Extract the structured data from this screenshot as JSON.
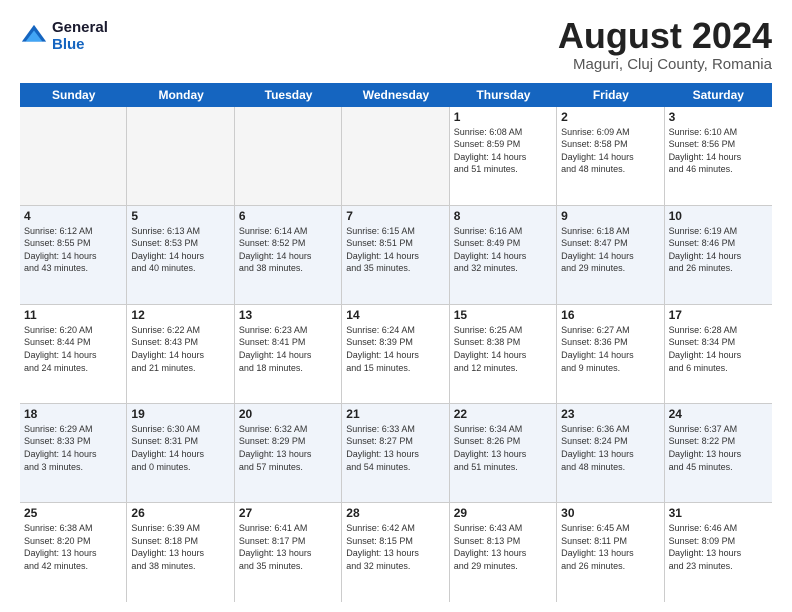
{
  "logo": {
    "general": "General",
    "blue": "Blue"
  },
  "title": "August 2024",
  "location": "Maguri, Cluj County, Romania",
  "days_of_week": [
    "Sunday",
    "Monday",
    "Tuesday",
    "Wednesday",
    "Thursday",
    "Friday",
    "Saturday"
  ],
  "weeks": [
    [
      {
        "day": "",
        "info": ""
      },
      {
        "day": "",
        "info": ""
      },
      {
        "day": "",
        "info": ""
      },
      {
        "day": "",
        "info": ""
      },
      {
        "day": "1",
        "info": "Sunrise: 6:08 AM\nSunset: 8:59 PM\nDaylight: 14 hours\nand 51 minutes."
      },
      {
        "day": "2",
        "info": "Sunrise: 6:09 AM\nSunset: 8:58 PM\nDaylight: 14 hours\nand 48 minutes."
      },
      {
        "day": "3",
        "info": "Sunrise: 6:10 AM\nSunset: 8:56 PM\nDaylight: 14 hours\nand 46 minutes."
      }
    ],
    [
      {
        "day": "4",
        "info": "Sunrise: 6:12 AM\nSunset: 8:55 PM\nDaylight: 14 hours\nand 43 minutes."
      },
      {
        "day": "5",
        "info": "Sunrise: 6:13 AM\nSunset: 8:53 PM\nDaylight: 14 hours\nand 40 minutes."
      },
      {
        "day": "6",
        "info": "Sunrise: 6:14 AM\nSunset: 8:52 PM\nDaylight: 14 hours\nand 38 minutes."
      },
      {
        "day": "7",
        "info": "Sunrise: 6:15 AM\nSunset: 8:51 PM\nDaylight: 14 hours\nand 35 minutes."
      },
      {
        "day": "8",
        "info": "Sunrise: 6:16 AM\nSunset: 8:49 PM\nDaylight: 14 hours\nand 32 minutes."
      },
      {
        "day": "9",
        "info": "Sunrise: 6:18 AM\nSunset: 8:47 PM\nDaylight: 14 hours\nand 29 minutes."
      },
      {
        "day": "10",
        "info": "Sunrise: 6:19 AM\nSunset: 8:46 PM\nDaylight: 14 hours\nand 26 minutes."
      }
    ],
    [
      {
        "day": "11",
        "info": "Sunrise: 6:20 AM\nSunset: 8:44 PM\nDaylight: 14 hours\nand 24 minutes."
      },
      {
        "day": "12",
        "info": "Sunrise: 6:22 AM\nSunset: 8:43 PM\nDaylight: 14 hours\nand 21 minutes."
      },
      {
        "day": "13",
        "info": "Sunrise: 6:23 AM\nSunset: 8:41 PM\nDaylight: 14 hours\nand 18 minutes."
      },
      {
        "day": "14",
        "info": "Sunrise: 6:24 AM\nSunset: 8:39 PM\nDaylight: 14 hours\nand 15 minutes."
      },
      {
        "day": "15",
        "info": "Sunrise: 6:25 AM\nSunset: 8:38 PM\nDaylight: 14 hours\nand 12 minutes."
      },
      {
        "day": "16",
        "info": "Sunrise: 6:27 AM\nSunset: 8:36 PM\nDaylight: 14 hours\nand 9 minutes."
      },
      {
        "day": "17",
        "info": "Sunrise: 6:28 AM\nSunset: 8:34 PM\nDaylight: 14 hours\nand 6 minutes."
      }
    ],
    [
      {
        "day": "18",
        "info": "Sunrise: 6:29 AM\nSunset: 8:33 PM\nDaylight: 14 hours\nand 3 minutes."
      },
      {
        "day": "19",
        "info": "Sunrise: 6:30 AM\nSunset: 8:31 PM\nDaylight: 14 hours\nand 0 minutes."
      },
      {
        "day": "20",
        "info": "Sunrise: 6:32 AM\nSunset: 8:29 PM\nDaylight: 13 hours\nand 57 minutes."
      },
      {
        "day": "21",
        "info": "Sunrise: 6:33 AM\nSunset: 8:27 PM\nDaylight: 13 hours\nand 54 minutes."
      },
      {
        "day": "22",
        "info": "Sunrise: 6:34 AM\nSunset: 8:26 PM\nDaylight: 13 hours\nand 51 minutes."
      },
      {
        "day": "23",
        "info": "Sunrise: 6:36 AM\nSunset: 8:24 PM\nDaylight: 13 hours\nand 48 minutes."
      },
      {
        "day": "24",
        "info": "Sunrise: 6:37 AM\nSunset: 8:22 PM\nDaylight: 13 hours\nand 45 minutes."
      }
    ],
    [
      {
        "day": "25",
        "info": "Sunrise: 6:38 AM\nSunset: 8:20 PM\nDaylight: 13 hours\nand 42 minutes."
      },
      {
        "day": "26",
        "info": "Sunrise: 6:39 AM\nSunset: 8:18 PM\nDaylight: 13 hours\nand 38 minutes."
      },
      {
        "day": "27",
        "info": "Sunrise: 6:41 AM\nSunset: 8:17 PM\nDaylight: 13 hours\nand 35 minutes."
      },
      {
        "day": "28",
        "info": "Sunrise: 6:42 AM\nSunset: 8:15 PM\nDaylight: 13 hours\nand 32 minutes."
      },
      {
        "day": "29",
        "info": "Sunrise: 6:43 AM\nSunset: 8:13 PM\nDaylight: 13 hours\nand 29 minutes."
      },
      {
        "day": "30",
        "info": "Sunrise: 6:45 AM\nSunset: 8:11 PM\nDaylight: 13 hours\nand 26 minutes."
      },
      {
        "day": "31",
        "info": "Sunrise: 6:46 AM\nSunset: 8:09 PM\nDaylight: 13 hours\nand 23 minutes."
      }
    ]
  ]
}
